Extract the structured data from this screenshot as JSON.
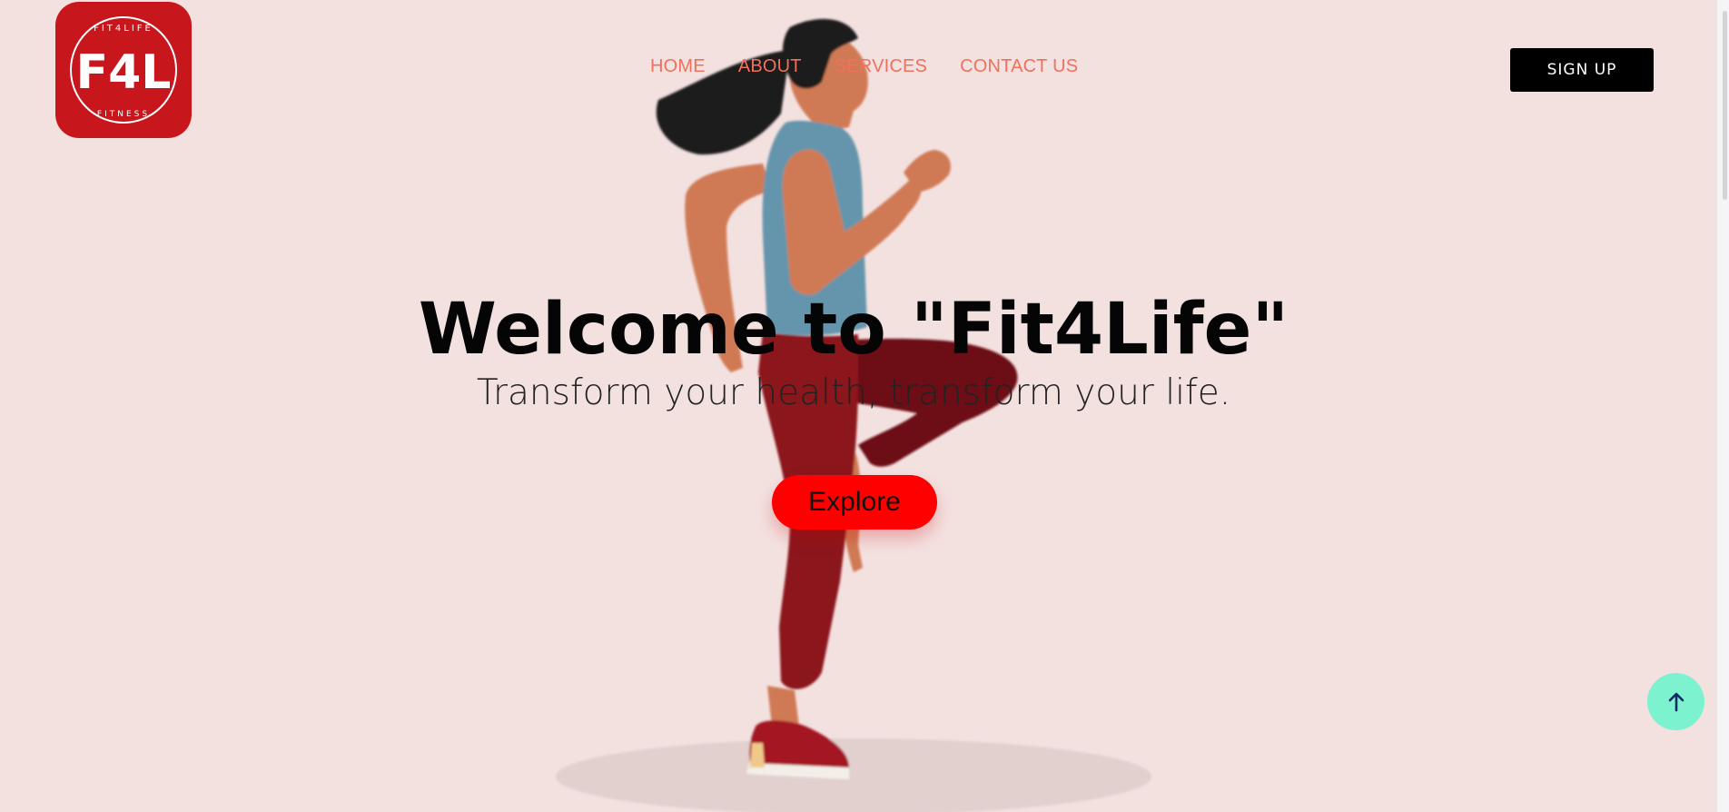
{
  "brand": {
    "logo_mark": "F4L",
    "logo_top_text": "FIT4LIFE",
    "logo_bottom_text": "FITNESS",
    "color": "#c8161d"
  },
  "nav": {
    "items": [
      {
        "label": "HOME"
      },
      {
        "label": "ABOUT"
      },
      {
        "label": "SERVICES"
      },
      {
        "label": "CONTACT US"
      }
    ],
    "color": "#f0705c"
  },
  "header": {
    "signup_label": "SIGN UP"
  },
  "hero": {
    "title": "Welcome to \"Fit4Life\"",
    "subtitle": "Transform your health, transform your life.",
    "cta_label": "Explore",
    "cta_color": "#ff0000",
    "background": "#f3e1e0"
  },
  "scroll_top": {
    "icon": "arrow-up-icon",
    "color": "#7cf2cf"
  }
}
